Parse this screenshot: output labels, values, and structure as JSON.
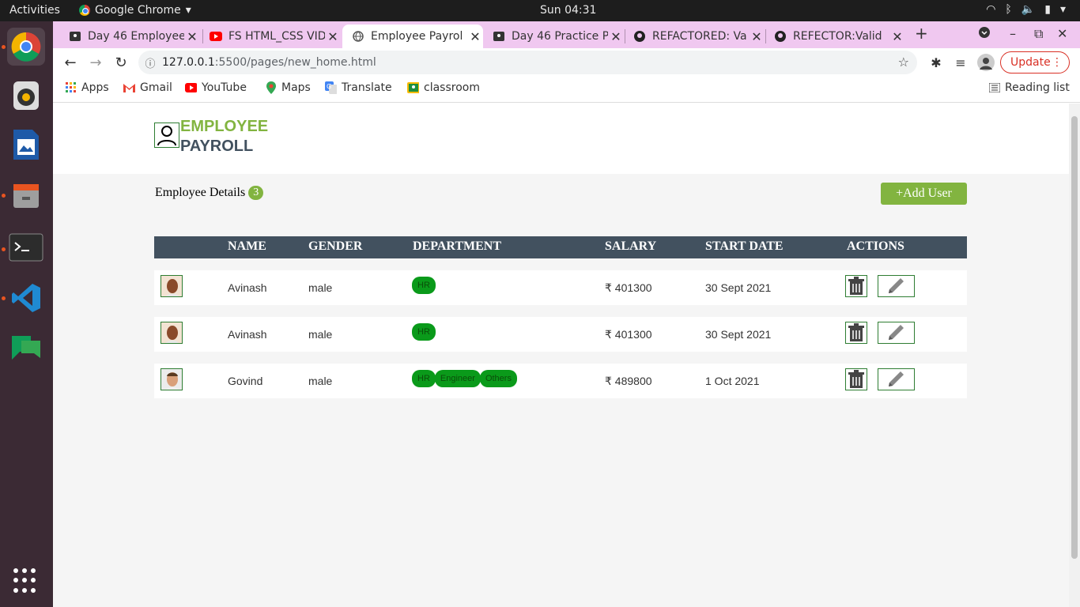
{
  "system_bar": {
    "activities": "Activities",
    "app_name": "Google Chrome",
    "clock": "Sun 04:31"
  },
  "dock": {
    "items": [
      "chrome-icon",
      "rhythmbox-icon",
      "writer-icon",
      "files-icon",
      "terminal-icon",
      "vscode-icon",
      "chat-icon"
    ],
    "show_apps_icon": "app-grid-icon"
  },
  "tabs": [
    {
      "title": "Day 46 Employee",
      "icon": "classroom-icon"
    },
    {
      "title": "FS HTML_CSS VID",
      "icon": "youtube-icon"
    },
    {
      "title": "Employee Payrol",
      "icon": "globe-icon",
      "active": true
    },
    {
      "title": "Day 46 Practice P",
      "icon": "classroom-icon"
    },
    {
      "title": "REFACTORED: Va",
      "icon": "github-icon"
    },
    {
      "title": "REFECTOR:Valid",
      "icon": "github-icon"
    }
  ],
  "toolbar": {
    "url_host": "127.0.0.1",
    "url_path": ":5500/pages/new_home.html",
    "update_label": "Update"
  },
  "bookmarks": [
    {
      "label": "Apps",
      "icon": "apps-icon"
    },
    {
      "label": "Gmail",
      "icon": "gmail-icon"
    },
    {
      "label": "YouTube",
      "icon": "youtube-icon"
    },
    {
      "label": "Maps",
      "icon": "maps-icon"
    },
    {
      "label": "Translate",
      "icon": "translate-icon"
    },
    {
      "label": "classroom",
      "icon": "classroom-icon"
    }
  ],
  "reading_list": "Reading list",
  "app": {
    "logo_line1": "EMPLOYEE",
    "logo_line2": "PAYROLL",
    "details_label": "Employee Details",
    "count": "3",
    "add_user_label": "+Add User"
  },
  "table": {
    "headers": [
      "NAME",
      "GENDER",
      "DEPARTMENT",
      "SALARY",
      "START DATE",
      "ACTIONS"
    ],
    "rows": [
      {
        "name": "Avinash",
        "gender": "male",
        "departments": [
          "HR"
        ],
        "salary": "₹ 401300",
        "start_date": "30 Sept 2021",
        "avatar": "avatar-male-1"
      },
      {
        "name": "Avinash",
        "gender": "male",
        "departments": [
          "HR"
        ],
        "salary": "₹ 401300",
        "start_date": "30 Sept 2021",
        "avatar": "avatar-male-1"
      },
      {
        "name": "Govind",
        "gender": "male",
        "departments": [
          "HR",
          "Engineer",
          "Others"
        ],
        "salary": "₹ 489800",
        "start_date": "1 Oct 2021",
        "avatar": "avatar-male-2"
      }
    ]
  },
  "colors": {
    "accent_green": "#82b440",
    "header_dark": "#42515f",
    "dept_badge": "#0a9a1a",
    "tab_strip": "#f0c8f0"
  }
}
